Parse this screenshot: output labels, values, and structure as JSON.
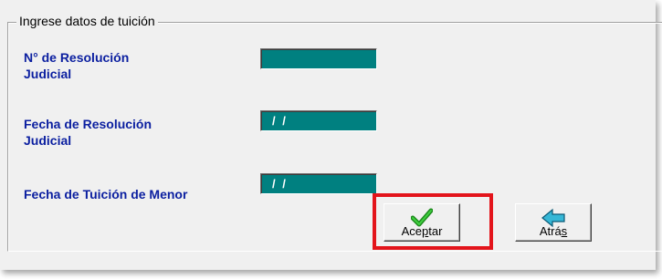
{
  "group": {
    "title": "Ingrese datos de tuición"
  },
  "fields": [
    {
      "label_line1": "N° de Resolución",
      "label_line2": "Judicial",
      "value": ""
    },
    {
      "label_line1": "Fecha de Resolución",
      "label_line2": "Judicial",
      "value": "/ /"
    },
    {
      "label_line1": "Fecha de Tuición de Menor",
      "label_line2": "",
      "value": "/ /"
    }
  ],
  "buttons": {
    "accept": {
      "label_pre": "Ace",
      "label_mnemonic": "p",
      "label_post": "tar",
      "icon": "checkmark-icon"
    },
    "back": {
      "label_pre": "Atrá",
      "label_mnemonic": "s",
      "label_post": "",
      "icon": "back-arrow-icon"
    }
  },
  "colors": {
    "field_bg": "#008080",
    "label": "#0b1fa0",
    "highlight": "#e3141b"
  }
}
